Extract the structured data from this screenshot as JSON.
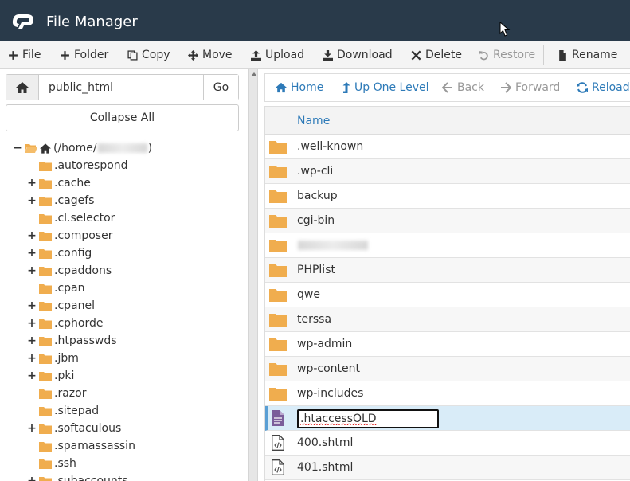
{
  "header": {
    "title": "File Manager"
  },
  "toolbar": {
    "buttons": [
      {
        "label": "File",
        "icon": "plus-icon"
      },
      {
        "label": "Folder",
        "icon": "plus-icon"
      },
      {
        "label": "Copy",
        "icon": "copy-icon"
      },
      {
        "label": "Move",
        "icon": "move-icon"
      },
      {
        "label": "Upload",
        "icon": "upload-icon"
      },
      {
        "label": "Download",
        "icon": "download-icon"
      },
      {
        "label": "Delete",
        "icon": "close-icon"
      },
      {
        "label": "Restore",
        "icon": "undo-icon"
      },
      {
        "label": "Rename",
        "icon": "file-icon"
      }
    ]
  },
  "left_panel": {
    "path_value": "public_html",
    "go_label": "Go",
    "collapse_label": "Collapse All",
    "tree": {
      "root_prefix": "(/home/",
      "root_suffix": ")",
      "items": [
        {
          "label": ".autorespond",
          "expandable": false
        },
        {
          "label": ".cache",
          "expandable": true
        },
        {
          "label": ".cagefs",
          "expandable": true
        },
        {
          "label": ".cl.selector",
          "expandable": false
        },
        {
          "label": ".composer",
          "expandable": true
        },
        {
          "label": ".config",
          "expandable": true
        },
        {
          "label": ".cpaddons",
          "expandable": true
        },
        {
          "label": ".cpan",
          "expandable": false
        },
        {
          "label": ".cpanel",
          "expandable": true
        },
        {
          "label": ".cphorde",
          "expandable": true
        },
        {
          "label": ".htpasswds",
          "expandable": true
        },
        {
          "label": ".jbm",
          "expandable": true
        },
        {
          "label": ".pki",
          "expandable": true
        },
        {
          "label": ".razor",
          "expandable": false
        },
        {
          "label": ".sitepad",
          "expandable": false
        },
        {
          "label": ".softaculous",
          "expandable": true
        },
        {
          "label": ".spamassassin",
          "expandable": false
        },
        {
          "label": ".ssh",
          "expandable": false
        },
        {
          "label": ".subaccounts",
          "expandable": true
        }
      ]
    }
  },
  "right_panel": {
    "nav": {
      "home": "Home",
      "up": "Up One Level",
      "back": "Back",
      "forward": "Forward",
      "reload": "Reload"
    },
    "columns": {
      "name": "Name"
    },
    "files": [
      {
        "name": ".well-known",
        "type": "folder"
      },
      {
        "name": ".wp-cli",
        "type": "folder"
      },
      {
        "name": "backup",
        "type": "folder"
      },
      {
        "name": "cgi-bin",
        "type": "folder"
      },
      {
        "name": "",
        "type": "folder",
        "obscured": true
      },
      {
        "name": "PHPlist",
        "type": "folder"
      },
      {
        "name": "qwe",
        "type": "folder"
      },
      {
        "name": "terssa",
        "type": "folder"
      },
      {
        "name": "wp-admin",
        "type": "folder"
      },
      {
        "name": "wp-content",
        "type": "folder"
      },
      {
        "name": "wp-includes",
        "type": "folder"
      },
      {
        "name": ".htaccessOLD",
        "type": "text",
        "renaming": true
      },
      {
        "name": "400.shtml",
        "type": "code"
      },
      {
        "name": "401.shtml",
        "type": "code"
      }
    ]
  },
  "colors": {
    "header_bg": "#293a4a",
    "accent": "#2d7ab8",
    "folder": "#f0ad4e",
    "selected_row": "#d9ecf8"
  }
}
